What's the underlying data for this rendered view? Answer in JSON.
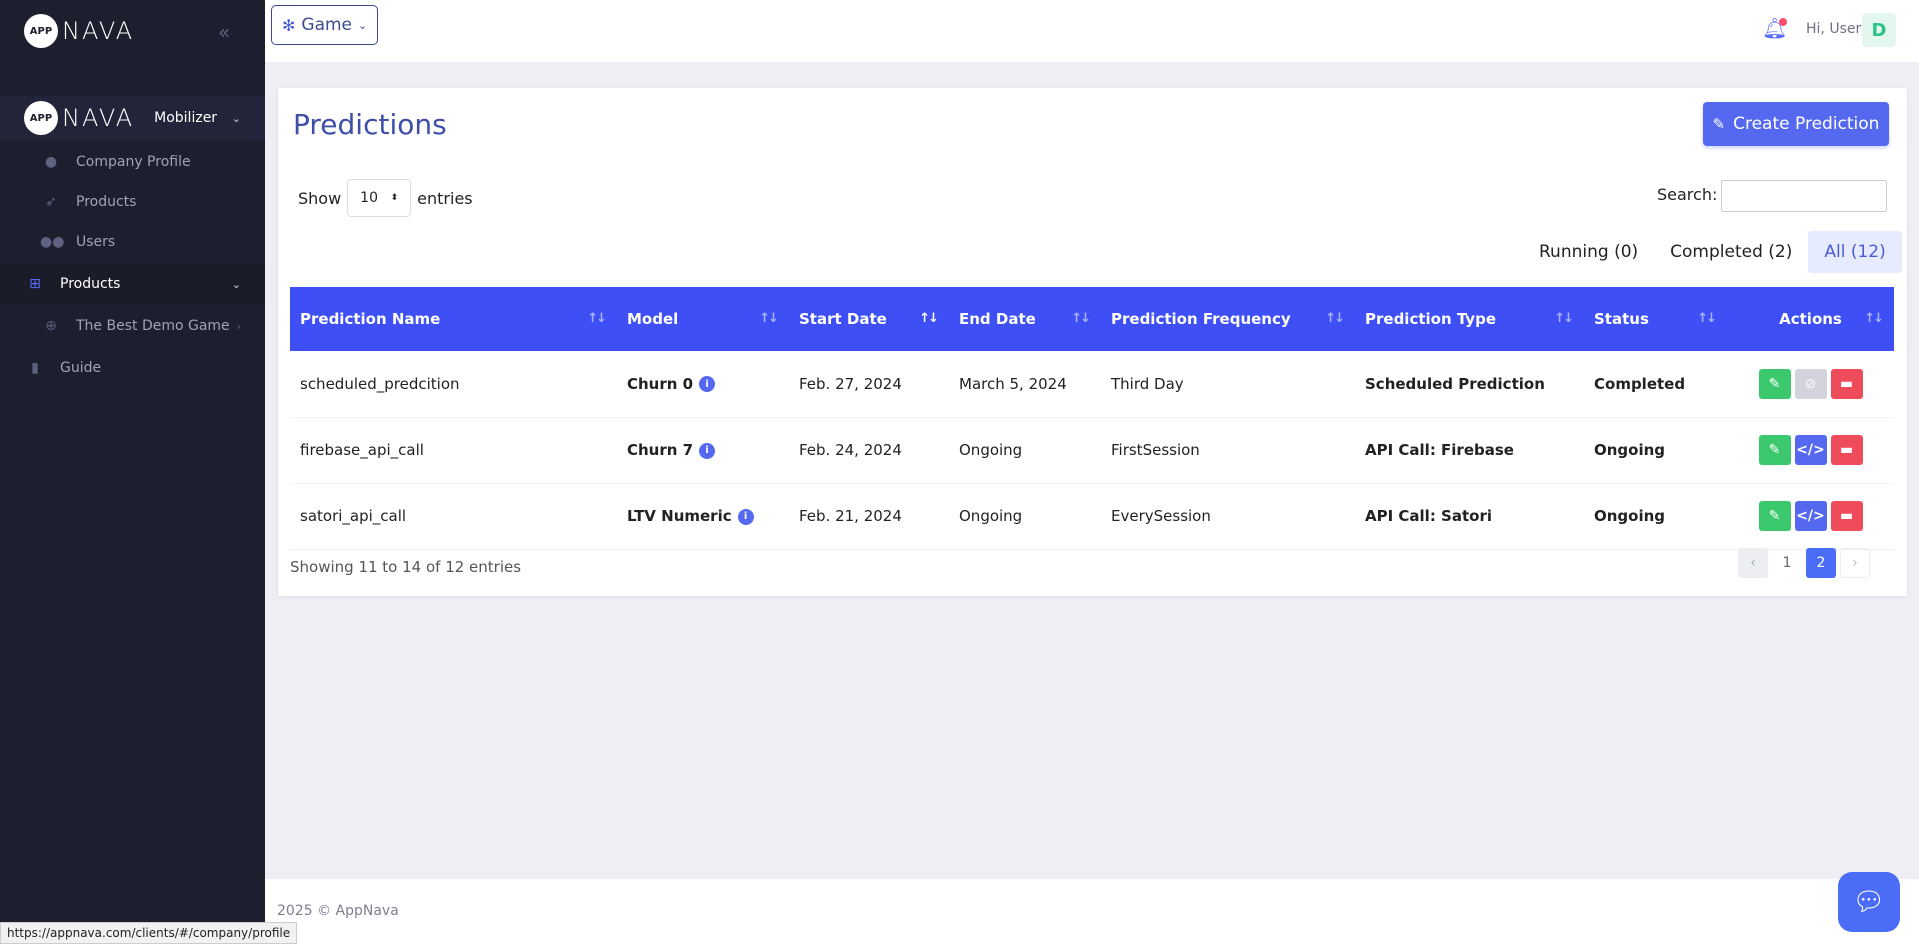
{
  "brand": {
    "mark": "APP",
    "name": "NAVA"
  },
  "sidebar": {
    "collapse_icon": "double-chevron-left-icon",
    "org": {
      "name": "Mobilizer"
    },
    "org_items": [
      {
        "label": "Company Profile",
        "icon": "user-icon"
      },
      {
        "label": "Products",
        "icon": "rocket-icon"
      },
      {
        "label": "Users",
        "icon": "users-icon"
      }
    ],
    "products": {
      "label": "Products",
      "icon": "sitemap-icon"
    },
    "product_items": [
      {
        "label": "The Best Demo Game",
        "icon": "gamepad-icon"
      }
    ],
    "guide": {
      "label": "Guide",
      "icon": "book-icon"
    }
  },
  "topbar": {
    "game_label": "Game",
    "greeting": "Hi, User",
    "avatar_initial": "D"
  },
  "page": {
    "title": "Predictions",
    "create_label": "Create Prediction",
    "show_label": "Show",
    "entries_value": "10",
    "entries_label": "entries",
    "search_label": "Search:",
    "tabs": [
      {
        "label": "Running (0)"
      },
      {
        "label": "Completed (2)"
      },
      {
        "label": "All (12)"
      }
    ],
    "columns": [
      "Prediction Name",
      "Model",
      "Start Date",
      "End Date",
      "Prediction Frequency",
      "Prediction Type",
      "Status",
      "Actions"
    ],
    "rows": [
      {
        "name": "scheduled_predcition",
        "model": "Churn 0",
        "start": "Feb. 27, 2024",
        "end": "March 5, 2024",
        "frequency": "Third Day",
        "type": "Scheduled Prediction",
        "status": "Completed"
      },
      {
        "name": "firebase_api_call",
        "model": "Churn 7",
        "start": "Feb. 24, 2024",
        "end": "Ongoing",
        "frequency": "FirstSession",
        "type": "API Call: Firebase",
        "status": "Ongoing"
      },
      {
        "name": "satori_api_call",
        "model": "LTV Numeric",
        "start": "Feb. 21, 2024",
        "end": "Ongoing",
        "frequency": "EverySession",
        "type": "API Call: Satori",
        "status": "Ongoing"
      }
    ],
    "showing_text": "Showing 11 to 14 of 12 entries",
    "pages": [
      "1",
      "2"
    ],
    "current_page": "2"
  },
  "footer": {
    "copyright": "2025 © AppNava"
  },
  "status_url": "https://appnava.com/clients/#/company/profile",
  "colors": {
    "sidebar": "#1e1f2e",
    "primary": "#5469f0",
    "table_header": "#3d4ff5",
    "success": "#3cc86d",
    "danger": "#ee4b5b"
  }
}
